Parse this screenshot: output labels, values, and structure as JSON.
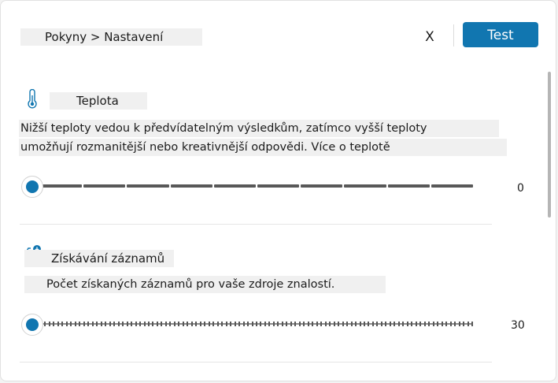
{
  "header": {
    "breadcrumb": "Pokyny > Nastavení",
    "close_label": "X",
    "test_label": "Test"
  },
  "temperature": {
    "title": "Teplota",
    "description_line1": "Nižší teploty vedou k předvídatelným výsledkům, zatímco vyšší teploty",
    "description_line2": "umožňují rozmanitější nebo kreativnější odpovědi. Více o teplotě",
    "value": "0",
    "slider_level": 0,
    "icon": "thermometer-icon"
  },
  "retrieval": {
    "title": "Získávání záznamů",
    "description": "Počet získaných záznamů pro vaše zdroje znalostí.",
    "value": "30",
    "slider_level": 0,
    "icon": "document-retrieval-icon"
  },
  "colors": {
    "accent": "#1176b0",
    "track": "#585858",
    "panel": "#ffffff"
  }
}
